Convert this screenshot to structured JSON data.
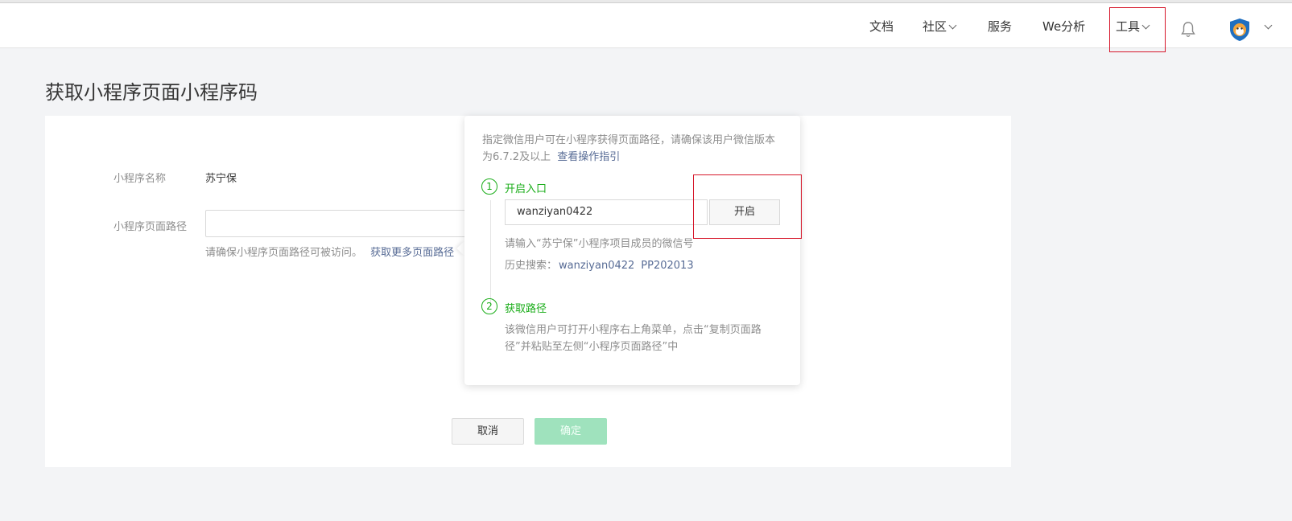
{
  "header": {
    "nav": [
      {
        "label": "文档"
      },
      {
        "label": "社区"
      },
      {
        "label": "服务"
      },
      {
        "label": "We分析"
      },
      {
        "label": "工具"
      }
    ],
    "highlight_color": "#d6172b"
  },
  "page": {
    "title": "获取小程序页面小程序码"
  },
  "form": {
    "name_label": "小程序名称",
    "name_value": "苏宁保",
    "path_label": "小程序页面路径",
    "path_value": "",
    "hint_text": "请确保小程序页面路径可被访问。",
    "hint_link": "获取更多页面路径",
    "cancel_label": "取消",
    "confirm_label": "确定"
  },
  "popover": {
    "desc": "指定微信用户可在小程序获得页面路径，请确保该用户微信版本为6.7.2及以上",
    "guide_link": "查看操作指引",
    "step1": {
      "num": "1",
      "title": "开启入口",
      "input_value": "wanziyan0422",
      "open_button": "开启",
      "input_hint": "请输入“苏宁保”小程序项目成员的微信号",
      "history_label": "历史搜索：",
      "history": [
        "wanziyan0422",
        "PP202013"
      ]
    },
    "step2": {
      "num": "2",
      "title": "获取路径",
      "desc": "该微信用户可打开小程序右上角菜单，点击“复制页面路径”并粘贴至左侧“小程序页面路径”中"
    }
  },
  "colors": {
    "accent_green": "#1aad19",
    "link": "#576b95",
    "confirm_disabled": "#9fe2bd"
  }
}
